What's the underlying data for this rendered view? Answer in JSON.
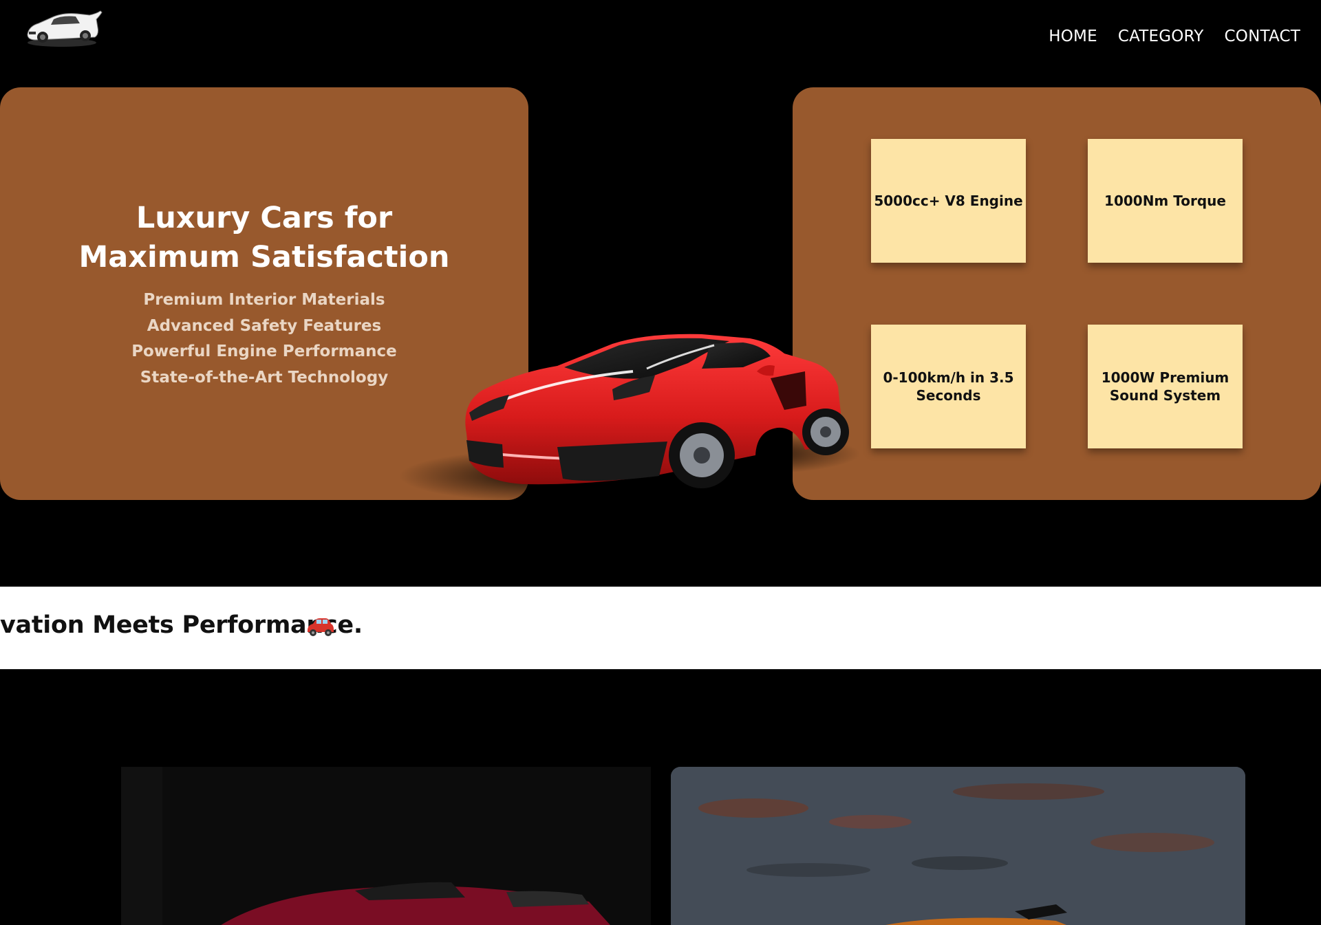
{
  "nav": {
    "items": [
      "HOME",
      "CATEGORY",
      "CONTACT"
    ]
  },
  "hero": {
    "title_line1": "Luxury Cars for",
    "title_line2": "Maximum Satisfaction",
    "features": [
      "Premium Interior Materials",
      "Advanced Safety Features",
      "Powerful Engine Performance",
      "State-of-the-Art Technology"
    ],
    "specs": [
      "5000cc+ V8 Engine",
      "1000Nm Torque",
      "0-100km/h in 3.5 Seconds",
      "1000W Premium Sound System"
    ]
  },
  "ticker": {
    "text": "vation Meets Performance."
  },
  "colors": {
    "panel": "#98592d",
    "card": "#fde4a6",
    "car": "#d81b1b"
  }
}
